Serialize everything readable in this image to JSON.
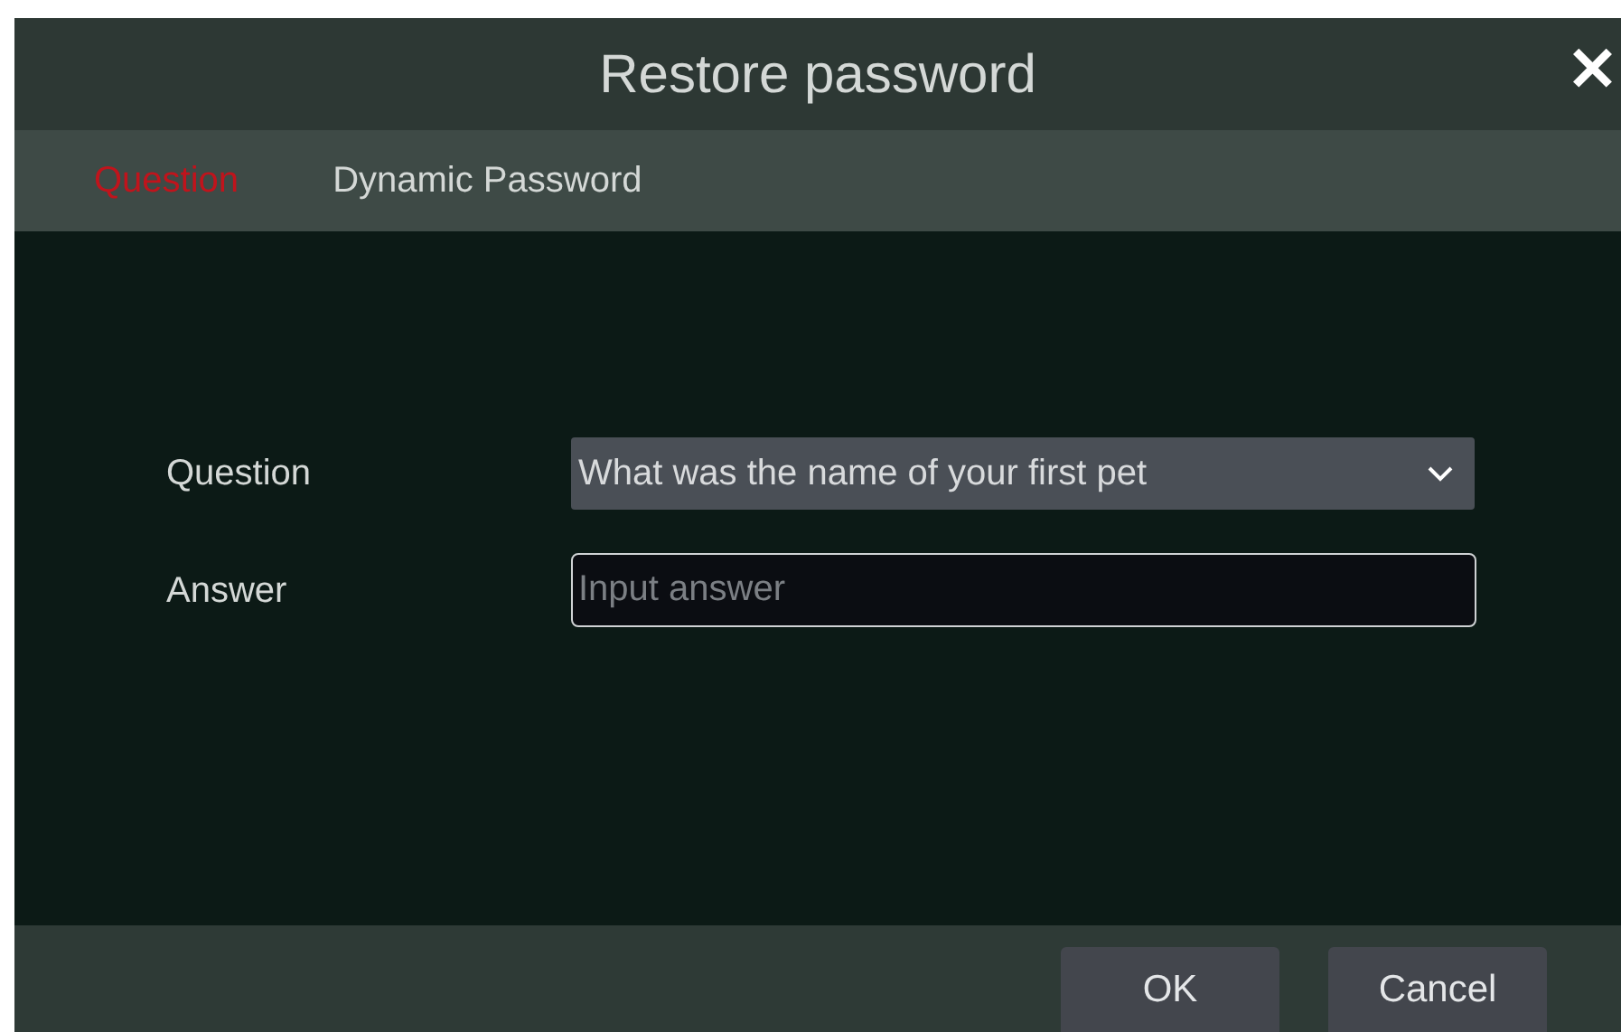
{
  "window": {
    "title": "Restore password",
    "close": "✕"
  },
  "tabs": [
    {
      "label": "Question",
      "selected": true
    },
    {
      "label": "Dynamic Password",
      "selected": false
    }
  ],
  "form": [
    {
      "kind": "select",
      "label": "Question",
      "value": "What was the name of your first pet"
    },
    {
      "kind": "input",
      "label": "Answer",
      "placeholder": "Input answer"
    }
  ],
  "buttons": [
    "OK",
    "Cancel"
  ]
}
